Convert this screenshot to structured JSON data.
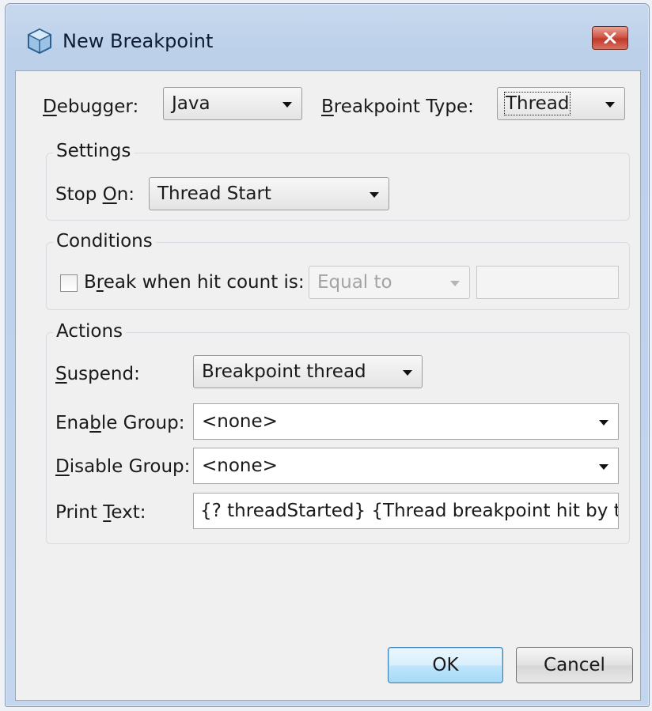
{
  "window": {
    "title": "New Breakpoint",
    "close_icon": "close-icon"
  },
  "top": {
    "debugger_label_pre": "",
    "debugger_label_u": "D",
    "debugger_label_post": "ebugger:",
    "debugger_value": "Java",
    "type_label_pre": "",
    "type_label_u": "B",
    "type_label_post": "reakpoint Type:",
    "type_value": "Thread"
  },
  "settings": {
    "legend": "Settings",
    "stop_on_pre": "Stop ",
    "stop_on_u": "O",
    "stop_on_post": "n:",
    "stop_on_value": "Thread Start"
  },
  "conditions": {
    "legend": "Conditions",
    "break_pre": "B",
    "break_u": "r",
    "break_post": "eak when hit count is:",
    "hit_mode": "Equal to",
    "hit_value": "",
    "checked": false
  },
  "actions": {
    "legend": "Actions",
    "suspend_pre": "",
    "suspend_u": "S",
    "suspend_post": "uspend:",
    "suspend_value": "Breakpoint thread",
    "enable_pre": "Ena",
    "enable_u": "b",
    "enable_post": "le Group:",
    "enable_value": "<none>",
    "disable_pre": "",
    "disable_u": "D",
    "disable_post": "isable Group:",
    "disable_value": "<none>",
    "print_pre": "Print ",
    "print_u": "T",
    "print_post": "ext:",
    "print_value": "{? threadStarted} {Thread breakpoint hit by th"
  },
  "buttons": {
    "ok": "OK",
    "cancel": "Cancel"
  }
}
